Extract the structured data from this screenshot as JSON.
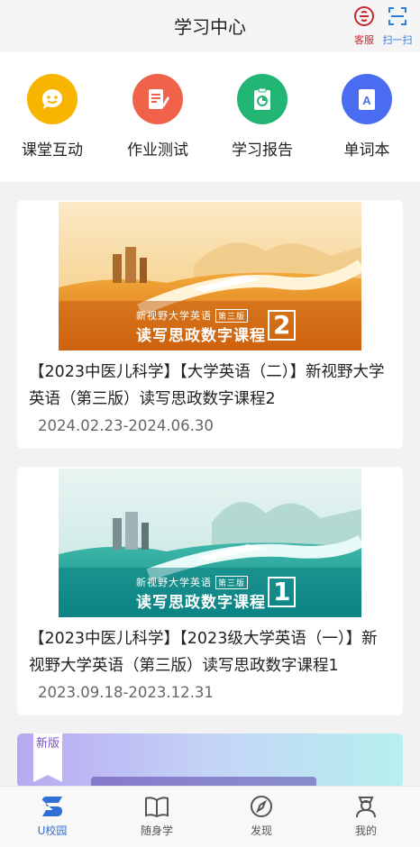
{
  "header": {
    "title": "学习中心",
    "service_label": "客服",
    "scan_label": "扫一扫"
  },
  "quick_entries": [
    {
      "label": "课堂互动",
      "icon": "smiley-chat-icon",
      "color": "#f7b500"
    },
    {
      "label": "作业测试",
      "icon": "document-pencil-icon",
      "color": "#f0624a"
    },
    {
      "label": "学习报告",
      "icon": "clipboard-chart-icon",
      "color": "#22b573"
    },
    {
      "label": "单词本",
      "icon": "letter-a-book-icon",
      "color": "#4a6cf0"
    }
  ],
  "courses": [
    {
      "title": "【2023中医儿科学】【大学英语（二）】新视野大学英语（第三版）读写思政数字课程2",
      "date": "2024.02.23-2024.06.30",
      "banner_top": "新视野大学英语",
      "banner_edition": "第三版",
      "banner_main": "读写思政数字课程",
      "banner_number": "2"
    },
    {
      "title": "【2023中医儿科学】【2023级大学英语（一）】新视野大学英语（第三版）读写思政数字课程1",
      "date": "2023.09.18-2023.12.31",
      "banner_top": "新视野大学英语",
      "banner_edition": "第三版",
      "banner_main": "读写思政数字课程",
      "banner_number": "1"
    }
  ],
  "partial_card": {
    "tag": "新版"
  },
  "tabbar": [
    {
      "label": "U校园",
      "icon": "u-campus-icon",
      "active": true
    },
    {
      "label": "随身学",
      "icon": "open-book-icon",
      "active": false
    },
    {
      "label": "发现",
      "icon": "compass-icon",
      "active": false
    },
    {
      "label": "我的",
      "icon": "user-profile-icon",
      "active": false
    }
  ],
  "colors": {
    "accent": "#2f6fd6",
    "service": "#c8262e",
    "scan": "#2b7fd9"
  }
}
